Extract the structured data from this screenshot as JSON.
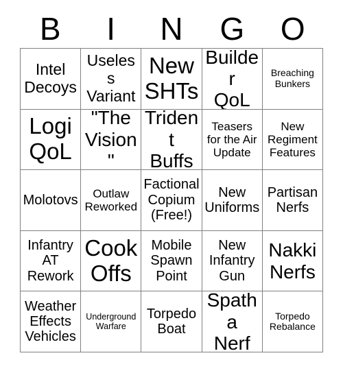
{
  "header": {
    "letters": [
      "B",
      "I",
      "N",
      "G",
      "O"
    ]
  },
  "grid": {
    "rows": 5,
    "columns": 5,
    "border_color": "#808080",
    "background_color": "#ffffff",
    "text_color": "#000000",
    "cells": [
      {
        "text": "Intel\nDecoys",
        "size": "fs-lg"
      },
      {
        "text": "Useless\nVariant",
        "size": "fs-lg"
      },
      {
        "text": "New\nSHTs",
        "size": "fs-xxl"
      },
      {
        "text": "Builder\nQoL",
        "size": "fs-xl"
      },
      {
        "text": "Breaching\nBunkers",
        "size": "fs-xs"
      },
      {
        "text": "Logi\nQoL",
        "size": "fs-xxl"
      },
      {
        "text": "\"The\nVision\"",
        "size": "fs-xl"
      },
      {
        "text": "Trident\nBuffs",
        "size": "fs-xl"
      },
      {
        "text": "Teasers\nfor the Air\nUpdate",
        "size": "fs-sm"
      },
      {
        "text": "New\nRegiment\nFeatures",
        "size": "fs-sm"
      },
      {
        "text": "Molotovs",
        "size": "fs-md"
      },
      {
        "text": "Outlaw\nReworked",
        "size": "fs-sm"
      },
      {
        "text": "Factional\nCopium\n(Free!)",
        "size": "fs-md"
      },
      {
        "text": "New\nUniforms",
        "size": "fs-md"
      },
      {
        "text": "Partisan\nNerfs",
        "size": "fs-md"
      },
      {
        "text": "Infantry\nAT\nRework",
        "size": "fs-md"
      },
      {
        "text": "Cook\nOffs",
        "size": "fs-xxl"
      },
      {
        "text": "Mobile\nSpawn\nPoint",
        "size": "fs-md"
      },
      {
        "text": "New\nInfantry\nGun",
        "size": "fs-md"
      },
      {
        "text": "Nakki\nNerfs",
        "size": "fs-xl"
      },
      {
        "text": "Weather\nEffects\nVehicles",
        "size": "fs-md"
      },
      {
        "text": "Underground\nWarfare",
        "size": "fs-xxs"
      },
      {
        "text": "Torpedo\nBoat",
        "size": "fs-md"
      },
      {
        "text": "Spatha\nNerf",
        "size": "fs-xl"
      },
      {
        "text": "Torpedo\nRebalance",
        "size": "fs-xs"
      }
    ]
  }
}
